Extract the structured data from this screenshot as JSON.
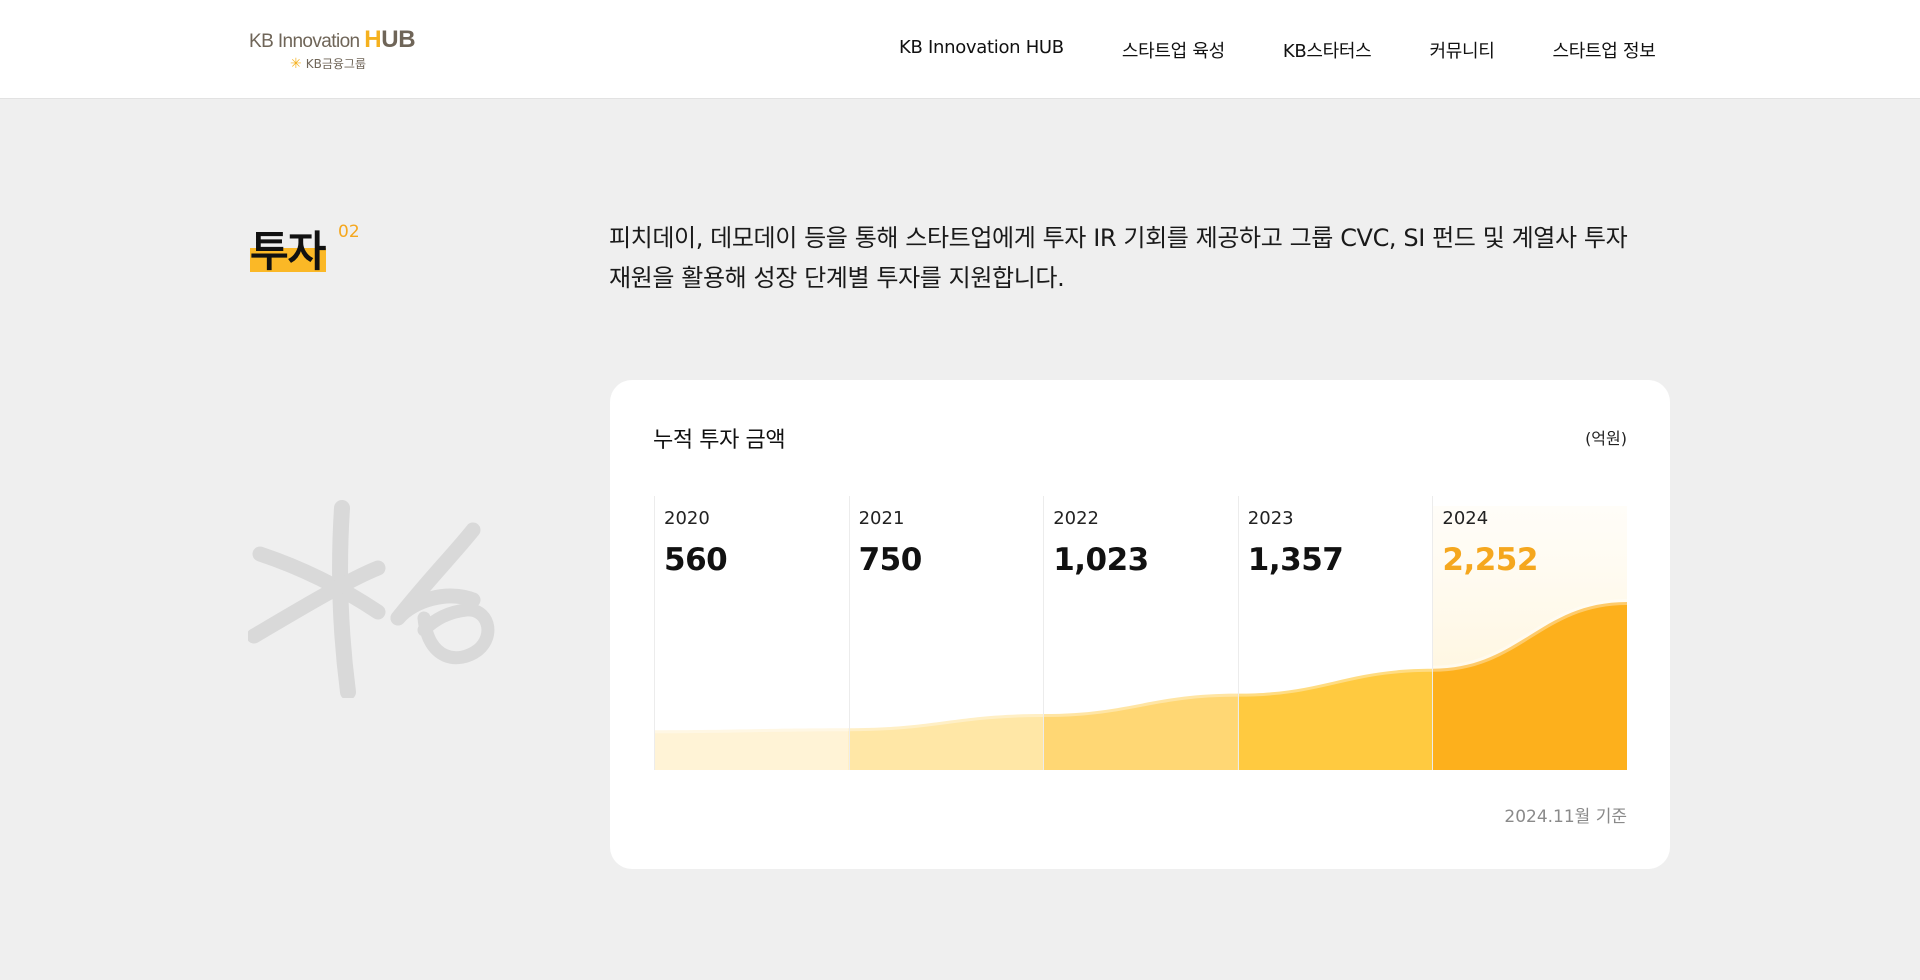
{
  "header": {
    "logo": {
      "main": "KB Innovation",
      "hub_h": "H",
      "hub_rest": "UB",
      "sub": "KB금융그룹",
      "mark_icon": "kb-star-icon"
    },
    "nav": [
      "KB Innovation HUB",
      "스타트업 육성",
      "KB스타터스",
      "커뮤니티",
      "스타트업 정보"
    ]
  },
  "section": {
    "title": "투자",
    "number": "02",
    "description_line1": "피치데이, 데모데이 등을 통해 스타트업에게 투자 IR 기회를 제공하고 그룹 CVC, SI 펀드 및 계열사 투자",
    "description_line2": "재원을 활용해 성장 단계별 투자를 지원합니다."
  },
  "card": {
    "title": "누적 투자 금액",
    "unit": "(억원)",
    "note": "2024.11월 기준"
  },
  "chart_data": {
    "type": "area",
    "title": "누적 투자 금액",
    "unit": "(억원)",
    "categories": [
      "2020",
      "2021",
      "2022",
      "2023",
      "2024"
    ],
    "values": [
      560,
      750,
      1023,
      1357,
      2252
    ],
    "value_labels": [
      "560",
      "750",
      "1,023",
      "1,357",
      "2,252"
    ],
    "highlight_index": 4,
    "colors": [
      "#fff3d6",
      "#ffe7a6",
      "#ffd774",
      "#ffca40",
      "#fdb01c"
    ],
    "highlight_color": "#f5a71e",
    "note": "2024.11월 기준"
  }
}
